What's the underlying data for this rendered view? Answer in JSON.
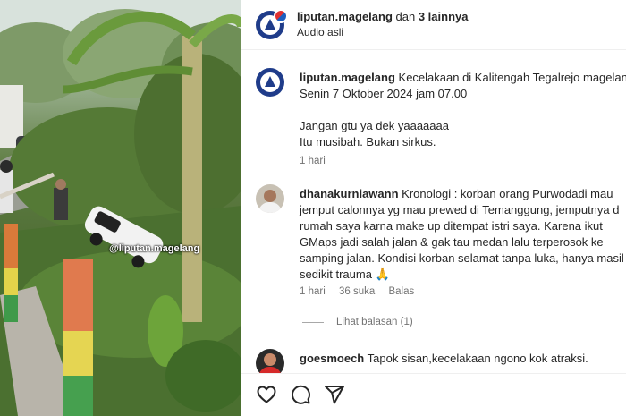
{
  "media": {
    "watermark": "@liputan.magelang"
  },
  "header": {
    "username": "liputan.magelang",
    "connector": " dan ",
    "others": "3 lainnya",
    "audio": "Audio asli"
  },
  "caption": {
    "username": "liputan.magelang",
    "line1": "Kecelakaan di Kalitengah Tegalrejo magelang",
    "line2": "Senin 7 Oktober 2024 jam 07.00",
    "line3": "Jangan gtu ya dek yaaaaaaa",
    "line4": "Itu musibah. Bukan sirkus.",
    "time": "1 hari"
  },
  "comments": [
    {
      "username": "dhanakurniawann",
      "lines": [
        "Kronologi : korban orang Purwodadi mau",
        "jemput calonnya yg mau prewed di Temanggung, jemputnya d",
        "rumah saya karna make up ditempat istri saya. Karena ikut",
        "GMaps jadi salah jalan & gak tau medan lalu terperosok ke",
        "samping jalan. Kondisi korban selamat tanpa luka, hanya masil",
        "sedikit trauma 🙏"
      ],
      "time": "1 hari",
      "likes": "36 suka",
      "reply": "Balas",
      "view_replies": "Lihat balasan (1)"
    },
    {
      "username": "goesmoech",
      "text": "Tapok sisan,kecelakaan ngono kok atraksi."
    }
  ],
  "actions": {
    "like": "heart-icon",
    "comment": "comment-icon",
    "share": "share-icon"
  }
}
